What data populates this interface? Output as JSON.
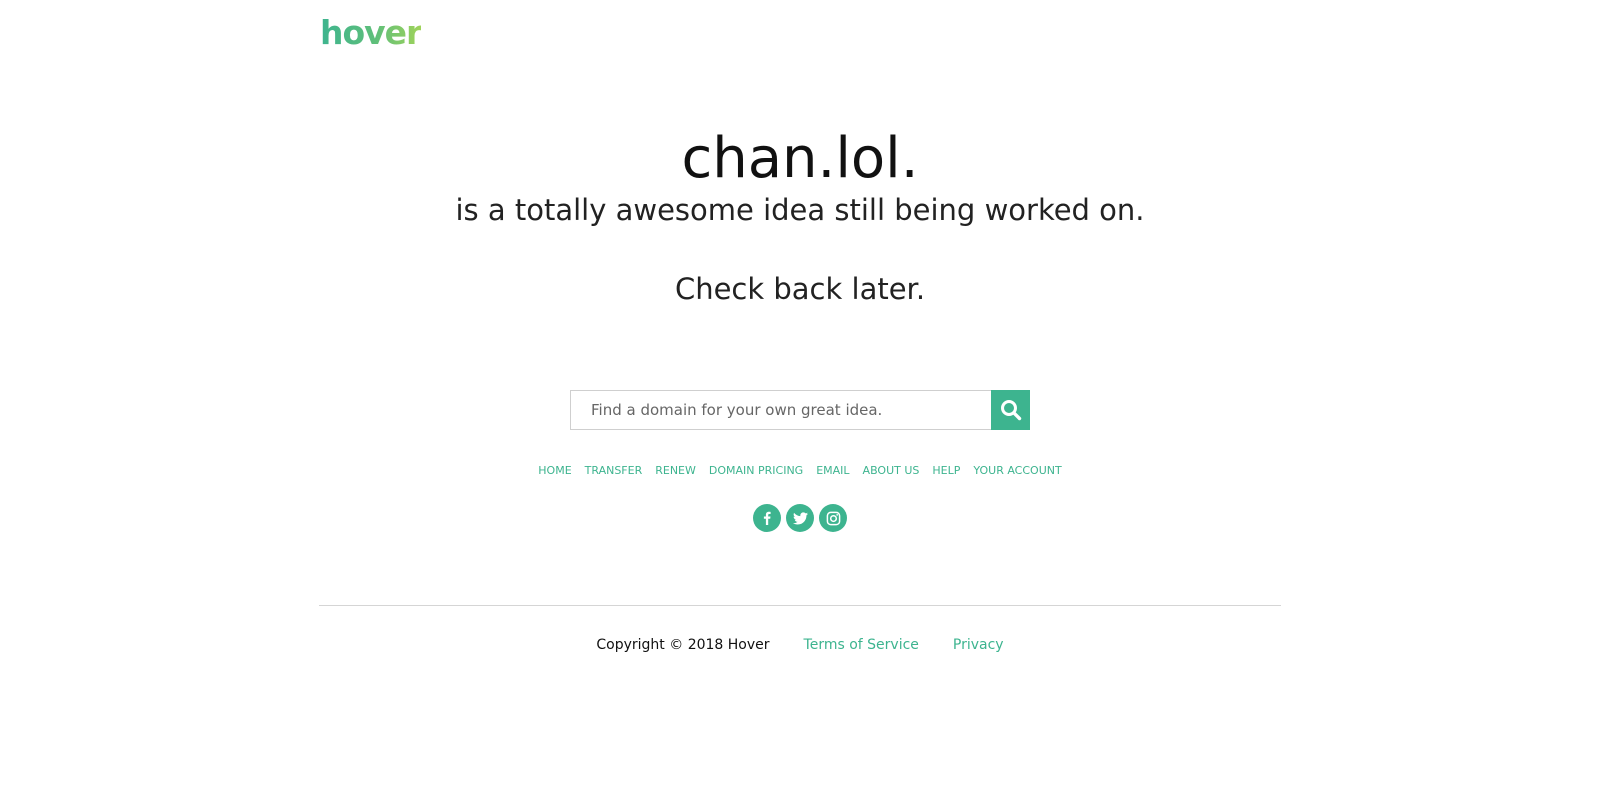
{
  "header": {
    "logo_text": "hover"
  },
  "main": {
    "domain": "chan.lol.",
    "subtitle": "is a totally awesome idea still being worked on.",
    "checkback": "Check back later."
  },
  "search": {
    "placeholder": "Find a domain for your own great idea.",
    "value": "",
    "button_icon": "search-icon"
  },
  "nav": {
    "items": [
      {
        "label": "HOME"
      },
      {
        "label": "TRANSFER"
      },
      {
        "label": "RENEW"
      },
      {
        "label": "DOMAIN PRICING"
      },
      {
        "label": "EMAIL"
      },
      {
        "label": "ABOUT US"
      },
      {
        "label": "HELP"
      },
      {
        "label": "YOUR ACCOUNT"
      }
    ]
  },
  "social": {
    "icons": [
      "facebook-icon",
      "twitter-icon",
      "instagram-icon"
    ]
  },
  "footer": {
    "copyright": "Copyright © 2018 Hover",
    "terms": "Terms of Service",
    "privacy": "Privacy"
  },
  "colors": {
    "accent": "#3db48f",
    "logo_gradient_end": "#9fd35a",
    "text": "#111111",
    "divider": "#d5d5d5"
  }
}
